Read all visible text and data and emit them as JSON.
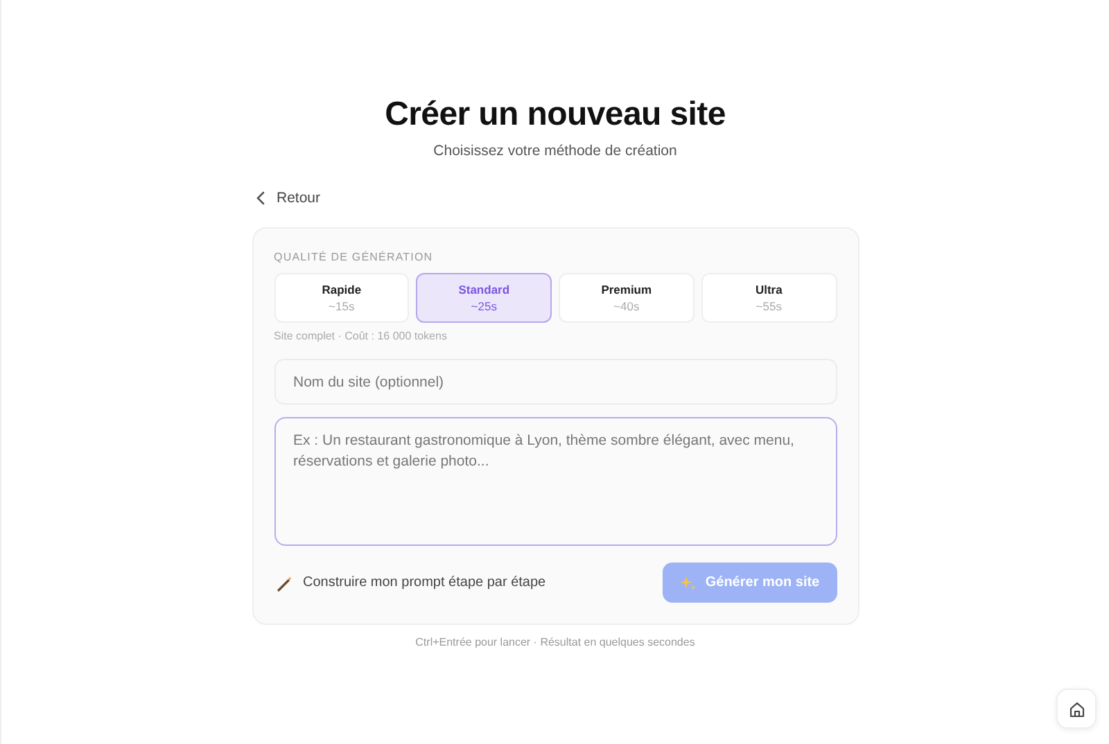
{
  "header": {
    "title": "Créer un nouveau site",
    "subtitle": "Choisissez votre méthode de création"
  },
  "back_link": {
    "label": "Retour"
  },
  "quality": {
    "label": "QUALITÉ DE GÉNÉRATION",
    "options": [
      {
        "name": "Rapide",
        "time": "~15s",
        "selected": false
      },
      {
        "name": "Standard",
        "time": "~25s",
        "selected": true
      },
      {
        "name": "Premium",
        "time": "~40s",
        "selected": false
      },
      {
        "name": "Ultra",
        "time": "~55s",
        "selected": false
      }
    ],
    "note": "Site complet · Coût : 16 000 tokens"
  },
  "name_field": {
    "placeholder": "Nom du site (optionnel)"
  },
  "prompt_field": {
    "placeholder": "Ex : Un restaurant gastronomique à Lyon, thème sombre élégant, avec menu, réservations et galerie photo..."
  },
  "builder_link": {
    "label": "Construire mon prompt étape par étape"
  },
  "generate_button": {
    "label": "Générer mon site",
    "disabled": true
  },
  "footer": "Ctrl+Entrée pour lancer · Résultat en quelques secondes"
}
